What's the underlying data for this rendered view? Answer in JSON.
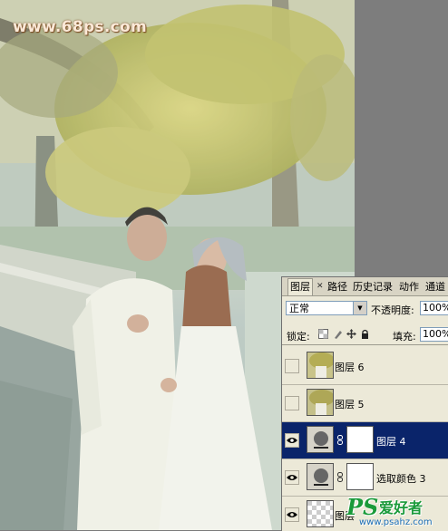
{
  "photo": {
    "watermark_url": "www.68ps.com"
  },
  "panel": {
    "tabs": [
      {
        "label": "图层",
        "active": true
      },
      {
        "label": "路径"
      },
      {
        "label": "历史记录"
      },
      {
        "label": "动作"
      },
      {
        "label": "通道"
      }
    ],
    "blend_mode": "正常",
    "opacity_label": "不透明度:",
    "opacity_value": "100%",
    "lock_label": "锁定:",
    "fill_label": "填充:",
    "fill_value": "100%",
    "layers": [
      {
        "name": "图层 6",
        "visible": false,
        "selected": false,
        "type": "photo"
      },
      {
        "name": "图层 5",
        "visible": false,
        "selected": false,
        "type": "photo"
      },
      {
        "name": "图层 4",
        "visible": true,
        "selected": true,
        "type": "adjustment"
      },
      {
        "name": "选取颜色 3",
        "visible": true,
        "selected": false,
        "type": "adjustment"
      },
      {
        "name": "图层",
        "visible": true,
        "selected": false,
        "type": "transparent"
      }
    ]
  },
  "site_watermark": {
    "logo": "PS",
    "name": "爱好者",
    "url": "www.psahz.com"
  },
  "colors": {
    "panel_bg": "#ece9d8",
    "selected_row": "#0a246a",
    "watermark_green": "#1a9a3a"
  }
}
